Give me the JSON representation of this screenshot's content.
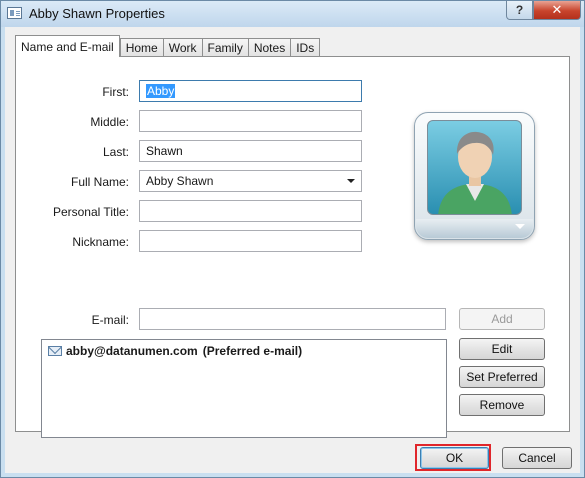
{
  "window": {
    "title": "Abby Shawn Properties",
    "help_label": "?",
    "close_label": "✕"
  },
  "tabs": [
    {
      "label": "Name and E-mail",
      "active": true
    },
    {
      "label": "Home"
    },
    {
      "label": "Work"
    },
    {
      "label": "Family"
    },
    {
      "label": "Notes"
    },
    {
      "label": "IDs"
    }
  ],
  "form": {
    "first_label": "First:",
    "first_value": "Abby",
    "middle_label": "Middle:",
    "middle_value": "",
    "last_label": "Last:",
    "last_value": "Shawn",
    "fullname_label": "Full Name:",
    "fullname_value": "Abby Shawn",
    "personal_title_label": "Personal Title:",
    "personal_title_value": "",
    "nickname_label": "Nickname:",
    "nickname_value": "",
    "email_label": "E-mail:",
    "email_value": ""
  },
  "email_list": [
    {
      "address": "abby@datanumen.com",
      "note": "(Preferred e-mail)"
    }
  ],
  "buttons": {
    "add": "Add",
    "edit": "Edit",
    "set_preferred": "Set Preferred",
    "remove": "Remove",
    "ok": "OK",
    "cancel": "Cancel"
  },
  "colors": {
    "highlight_box": "#e0262b",
    "selection": "#3399ff"
  }
}
